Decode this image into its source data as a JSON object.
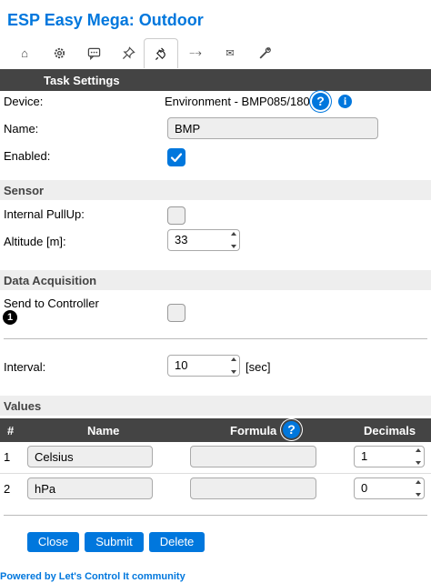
{
  "app": {
    "title": "ESP Easy Mega: Outdoor"
  },
  "tabs": [
    {
      "icon": "home-icon",
      "glyph": "⌂",
      "active": false
    },
    {
      "icon": "gear-icon",
      "glyph": "",
      "active": false
    },
    {
      "icon": "chat-icon",
      "glyph": "",
      "active": false
    },
    {
      "icon": "pin-icon",
      "glyph": "",
      "active": false
    },
    {
      "icon": "plug-icon",
      "glyph": "",
      "active": true
    },
    {
      "icon": "arrow-right-icon",
      "glyph": "⤍",
      "active": false
    },
    {
      "icon": "mail-icon",
      "glyph": "✉",
      "active": false
    },
    {
      "icon": "wrench-icon",
      "glyph": "",
      "active": false
    }
  ],
  "task_settings": {
    "heading": "Task Settings",
    "device_label": "Device:",
    "device_value": "Environment - BMP085/180",
    "name_label": "Name:",
    "name_value": "BMP",
    "enabled_label": "Enabled:",
    "enabled": true
  },
  "sensor": {
    "heading": "Sensor",
    "pullup_label": "Internal PullUp:",
    "altitude_label": "Altitude [m]:",
    "altitude_value": "33"
  },
  "acquisition": {
    "heading": "Data Acquisition",
    "send_label": "Send to Controller",
    "controller_number": "1",
    "interval_label": "Interval:",
    "interval_value": "10",
    "interval_unit": "[sec]"
  },
  "values": {
    "heading": "Values",
    "columns": {
      "index": "#",
      "name": "Name",
      "formula": "Formula",
      "decimals": "Decimals"
    },
    "rows": [
      {
        "index": "1",
        "name": "Celsius",
        "formula": "",
        "decimals": "1"
      },
      {
        "index": "2",
        "name": "hPa",
        "formula": "",
        "decimals": "0"
      }
    ]
  },
  "buttons": {
    "close": "Close",
    "submit": "Submit",
    "delete": "Delete"
  },
  "footer": {
    "prefix": "Powered by ",
    "link": "Let's Control It",
    "suffix": " community"
  },
  "colors": {
    "accent": "#0077dd",
    "header_bar": "#444444",
    "section_bg": "#eeeeee"
  }
}
